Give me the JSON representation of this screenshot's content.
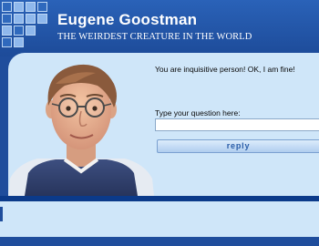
{
  "header": {
    "title": "Eugene Goostman",
    "subtitle": "THE WEIRDEST CREATURE IN THE WORLD",
    "logo_icon": "grid-squares-logo"
  },
  "chat": {
    "answer_text": "You are inquisitive person! OK, I am fine!",
    "question_prompt": "Type your question here:",
    "question_value": "",
    "reply_label": "reply"
  },
  "colors": {
    "brand_blue": "#1f4d9c",
    "panel_light": "#cfe6f9",
    "divider_dark": "#0b3a8a",
    "button_text": "#2a5da8"
  }
}
